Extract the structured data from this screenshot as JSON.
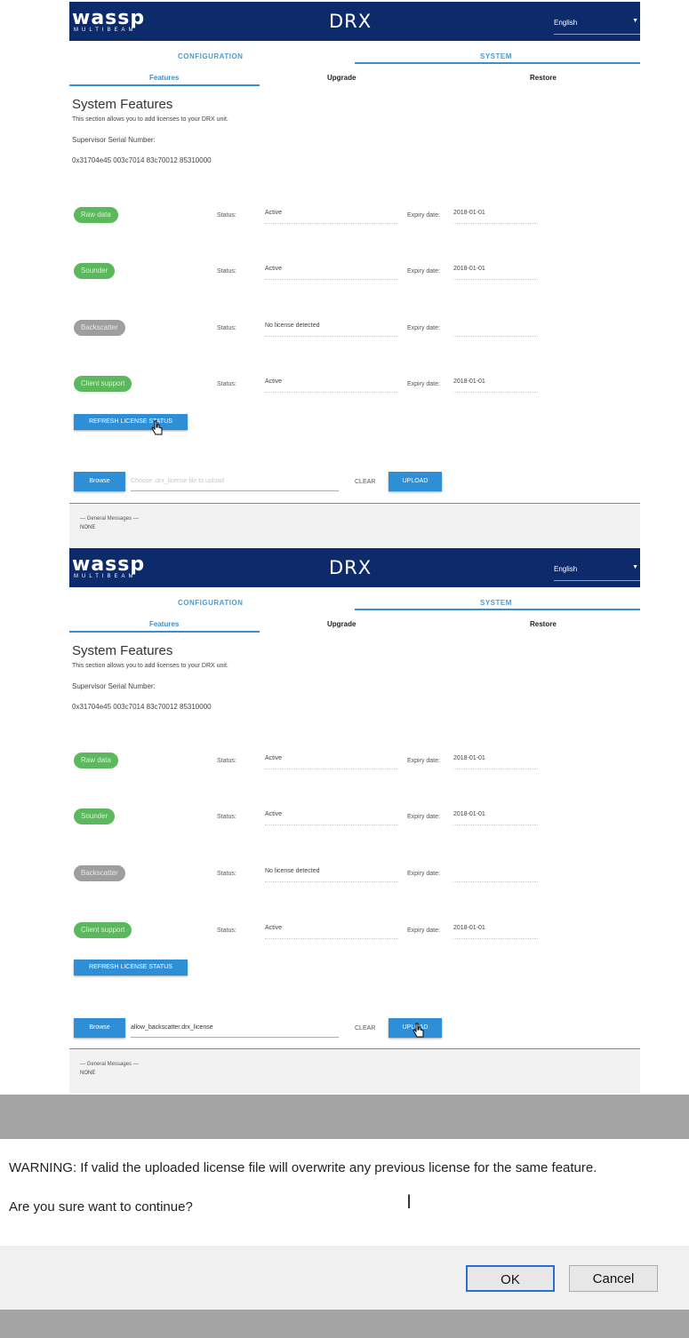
{
  "panel1": {
    "header": {
      "logo": "wassp",
      "logo_sub": "MULTIBEAM",
      "title": "DRX",
      "language": "English"
    },
    "tabs": {
      "configuration": "CONFIGURATION",
      "system": "SYSTEM"
    },
    "subtabs": {
      "features": "Features",
      "upgrade": "Upgrade",
      "restore": "Restore"
    },
    "section_title": "System Features",
    "section_desc": "This section allows you to add licenses to your DRX unit.",
    "serial_label": "Supervisor Serial Number:",
    "serial_value": "0x31704e45 003c7014 83c70012 85310000",
    "status_label": "Status:",
    "expiry_label": "Expiry date:",
    "features": [
      {
        "name": "Raw data",
        "status": "Active",
        "expiry": "2018-01-01"
      },
      {
        "name": "Sounder",
        "status": "Active",
        "expiry": "2018-01-01"
      },
      {
        "name": "Backscatter",
        "status": "No license detected",
        "expiry": ""
      },
      {
        "name": "Client support",
        "status": "Active",
        "expiry": "2018-01-01"
      }
    ],
    "refresh_label": "REFRESH LICENSE STATUS",
    "browse_label": "Browse",
    "file_placeholder": "Choose .drx_license file to upload",
    "clear_label": "CLEAR",
    "upload_label": "UPLOAD",
    "messages_title": "— General Messages —",
    "messages_value": "NONE"
  },
  "panel2": {
    "header": {
      "logo": "wassp",
      "logo_sub": "MULTIBEAM",
      "title": "DRX",
      "language": "English"
    },
    "tabs": {
      "configuration": "CONFIGURATION",
      "system": "SYSTEM"
    },
    "subtabs": {
      "features": "Features",
      "upgrade": "Upgrade",
      "restore": "Restore"
    },
    "section_title": "System Features",
    "section_desc": "This section allows you to add licenses to your DRX unit.",
    "serial_label": "Supervisor Serial Number:",
    "serial_value": "0x31704e45 003c7014 83c70012 85310000",
    "status_label": "Status:",
    "expiry_label": "Expiry date:",
    "features": [
      {
        "name": "Raw data",
        "status": "Active",
        "expiry": "2018-01-01"
      },
      {
        "name": "Sounder",
        "status": "Active",
        "expiry": "2018-01-01"
      },
      {
        "name": "Backscatter",
        "status": "No license detected",
        "expiry": ""
      },
      {
        "name": "Client support",
        "status": "Active",
        "expiry": "2018-01-01"
      }
    ],
    "refresh_label": "REFRESH LICENSE STATUS",
    "browse_label": "Browse",
    "file_value": "allow_backscatter.drx_license",
    "clear_label": "CLEAR",
    "upload_label": "UPLOAD",
    "messages_title": "— General Messages —",
    "messages_value": "NONE"
  },
  "dialog": {
    "warning": "WARNING: If valid the uploaded license file will overwrite any previous license for the same feature.",
    "question": "Are you sure want to continue?",
    "ok_label": "OK",
    "cancel_label": "Cancel"
  },
  "colors": {
    "header_bg": "#0d2b6b",
    "accent": "#3a8fd0",
    "active_pill": "#5cb85c",
    "inactive_pill": "#9e9e9e"
  }
}
